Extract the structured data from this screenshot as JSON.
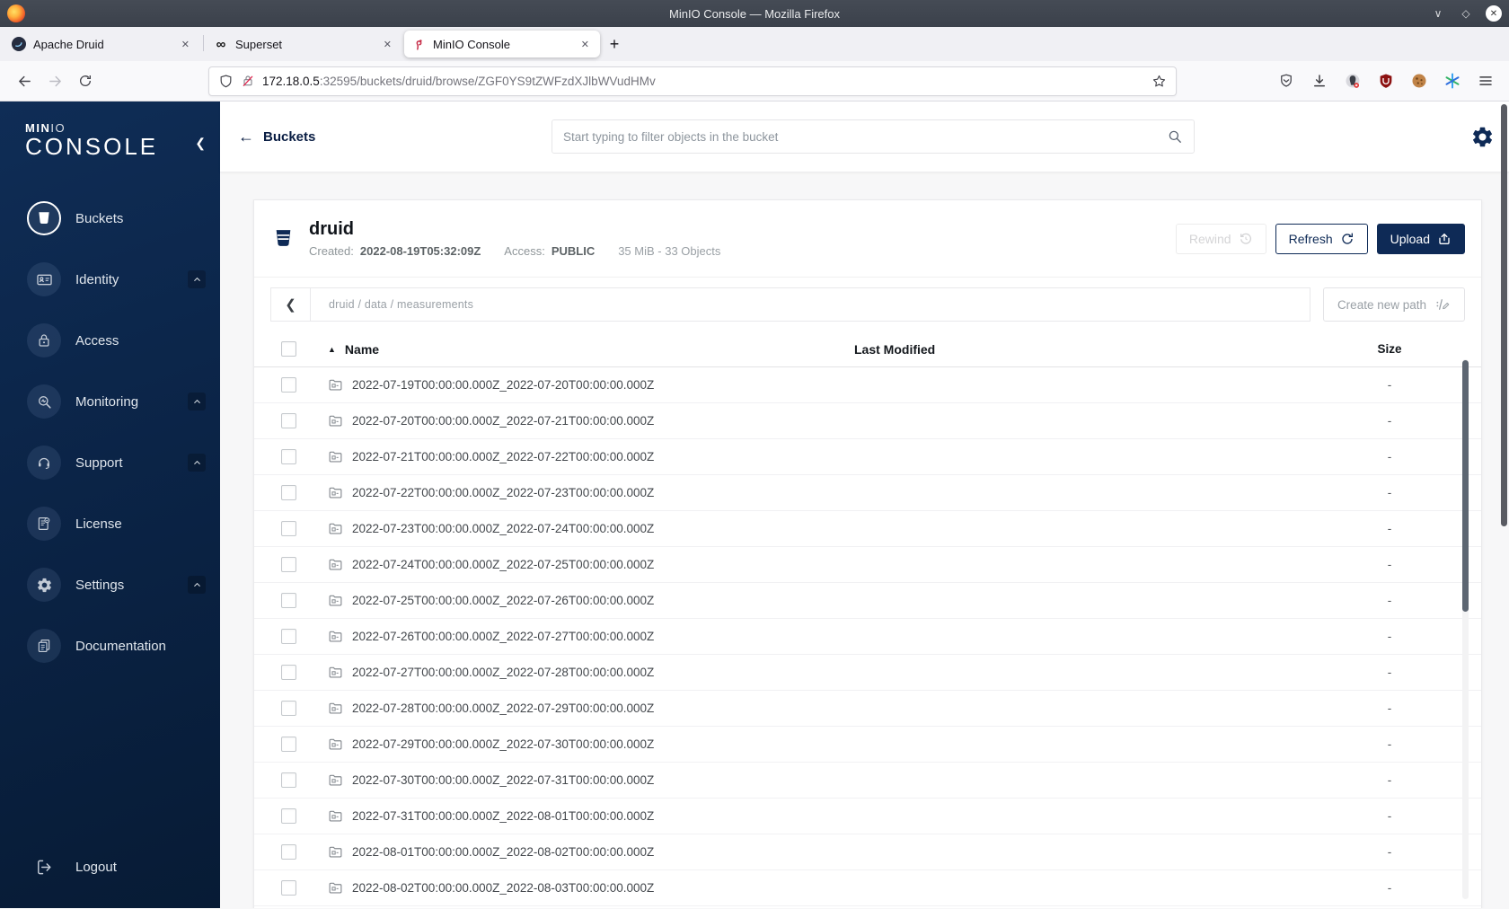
{
  "colors": {
    "navy_primary": "#0e2a56",
    "sidebar_top": "#0f2d56",
    "sidebar_bottom": "#071b35",
    "page_background": "#f7f7f8",
    "titlebar": "#3e444e",
    "minio_flamingo": "#c72e49"
  },
  "icons": {
    "close_tab": "✕",
    "new_tab": "+",
    "superset_glyph": "∞",
    "minimize": "∨",
    "maximize": "◇",
    "close_window": "✕",
    "collapse_sidebar": "❮",
    "crumb_back": "❮",
    "back_arrow": "←",
    "sort_asc": "▲"
  },
  "browser": {
    "window_title": "MinIO Console — Mozilla Firefox",
    "tabs": [
      {
        "title": "Apache Druid"
      },
      {
        "title": "Superset"
      },
      {
        "title": "MinIO Console",
        "active": true
      }
    ],
    "url_host": "172.18.0.5",
    "url_path": ":32595/buckets/druid/browse/ZGF0YS9tZWFzdXJlbWVudHMv"
  },
  "sidebar": {
    "logo_bold": "MIN",
    "logo_light": "IO",
    "logo_name": "CONSOLE",
    "items": [
      {
        "label": "Buckets",
        "active": true
      },
      {
        "label": "Identity",
        "expandable": true
      },
      {
        "label": "Access"
      },
      {
        "label": "Monitoring",
        "expandable": true
      },
      {
        "label": "Support",
        "expandable": true
      },
      {
        "label": "License"
      },
      {
        "label": "Settings",
        "expandable": true
      },
      {
        "label": "Documentation"
      }
    ],
    "logout_label": "Logout"
  },
  "header": {
    "back_label": "Buckets",
    "search_placeholder": "Start typing to filter objects in the bucket"
  },
  "bucket": {
    "name": "druid",
    "created_label": "Created:",
    "created_value": "2022-08-19T05:32:09Z",
    "access_label": "Access:",
    "access_value": "PUBLIC",
    "usage": "35 MiB - 33 Objects",
    "rewind_label": "Rewind",
    "refresh_label": "Refresh",
    "upload_label": "Upload"
  },
  "browse": {
    "breadcrumb": "druid / data / measurements",
    "create_path_label": "Create new path"
  },
  "table": {
    "headers": {
      "name": "Name",
      "last_modified": "Last Modified",
      "size": "Size"
    },
    "rows": [
      {
        "name": "2022-07-19T00:00:00.000Z_2022-07-20T00:00:00.000Z",
        "size": "-"
      },
      {
        "name": "2022-07-20T00:00:00.000Z_2022-07-21T00:00:00.000Z",
        "size": "-"
      },
      {
        "name": "2022-07-21T00:00:00.000Z_2022-07-22T00:00:00.000Z",
        "size": "-"
      },
      {
        "name": "2022-07-22T00:00:00.000Z_2022-07-23T00:00:00.000Z",
        "size": "-"
      },
      {
        "name": "2022-07-23T00:00:00.000Z_2022-07-24T00:00:00.000Z",
        "size": "-"
      },
      {
        "name": "2022-07-24T00:00:00.000Z_2022-07-25T00:00:00.000Z",
        "size": "-"
      },
      {
        "name": "2022-07-25T00:00:00.000Z_2022-07-26T00:00:00.000Z",
        "size": "-"
      },
      {
        "name": "2022-07-26T00:00:00.000Z_2022-07-27T00:00:00.000Z",
        "size": "-"
      },
      {
        "name": "2022-07-27T00:00:00.000Z_2022-07-28T00:00:00.000Z",
        "size": "-"
      },
      {
        "name": "2022-07-28T00:00:00.000Z_2022-07-29T00:00:00.000Z",
        "size": "-"
      },
      {
        "name": "2022-07-29T00:00:00.000Z_2022-07-30T00:00:00.000Z",
        "size": "-"
      },
      {
        "name": "2022-07-30T00:00:00.000Z_2022-07-31T00:00:00.000Z",
        "size": "-"
      },
      {
        "name": "2022-07-31T00:00:00.000Z_2022-08-01T00:00:00.000Z",
        "size": "-"
      },
      {
        "name": "2022-08-01T00:00:00.000Z_2022-08-02T00:00:00.000Z",
        "size": "-"
      },
      {
        "name": "2022-08-02T00:00:00.000Z_2022-08-03T00:00:00.000Z",
        "size": "-"
      }
    ]
  }
}
